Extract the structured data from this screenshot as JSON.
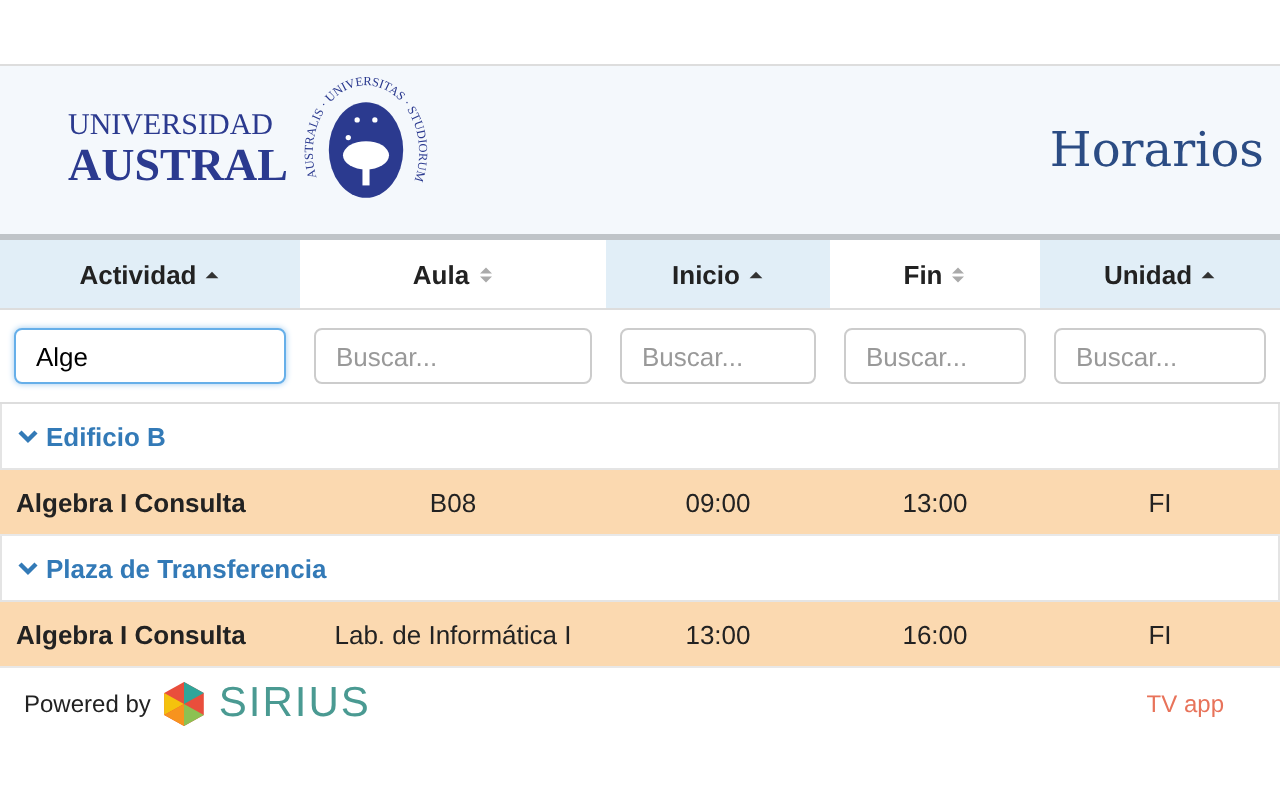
{
  "logo": {
    "line_1": "UNIVERSIDAD",
    "line_2": "AUSTRAL",
    "seal_text": "AUSTRALIS · UNIVERSITAS · STUDIORUM"
  },
  "page_title": "Horarios",
  "table": {
    "columns": [
      {
        "label": "Actividad",
        "sorted": true
      },
      {
        "label": "Aula",
        "sorted": false
      },
      {
        "label": "Inicio",
        "sorted": true
      },
      {
        "label": "Fin",
        "sorted": false
      },
      {
        "label": "Unidad",
        "sorted": true
      }
    ],
    "filters": [
      {
        "value": "Alge",
        "focused": true
      },
      {
        "placeholder": "Buscar...",
        "focused": false
      },
      {
        "placeholder": "Buscar...",
        "focused": false
      },
      {
        "placeholder": "Buscar...",
        "focused": false
      },
      {
        "placeholder": "Buscar...",
        "focused": false
      }
    ],
    "groups": [
      {
        "name": "Edificio B",
        "expanded": true,
        "rows": [
          {
            "cells": [
              "Algebra I Consulta",
              "B08",
              "09:00",
              "13:00",
              "FI"
            ]
          }
        ]
      },
      {
        "name": "Plaza de Transferencia",
        "expanded": true,
        "rows": [
          {
            "cells": [
              "Algebra I Consulta",
              "Lab. de Informática I",
              "13:00",
              "16:00",
              "FI"
            ]
          }
        ]
      }
    ]
  },
  "footer": {
    "powered_by": "Powered by",
    "brand": "SIRIUS",
    "link": "TV app"
  }
}
